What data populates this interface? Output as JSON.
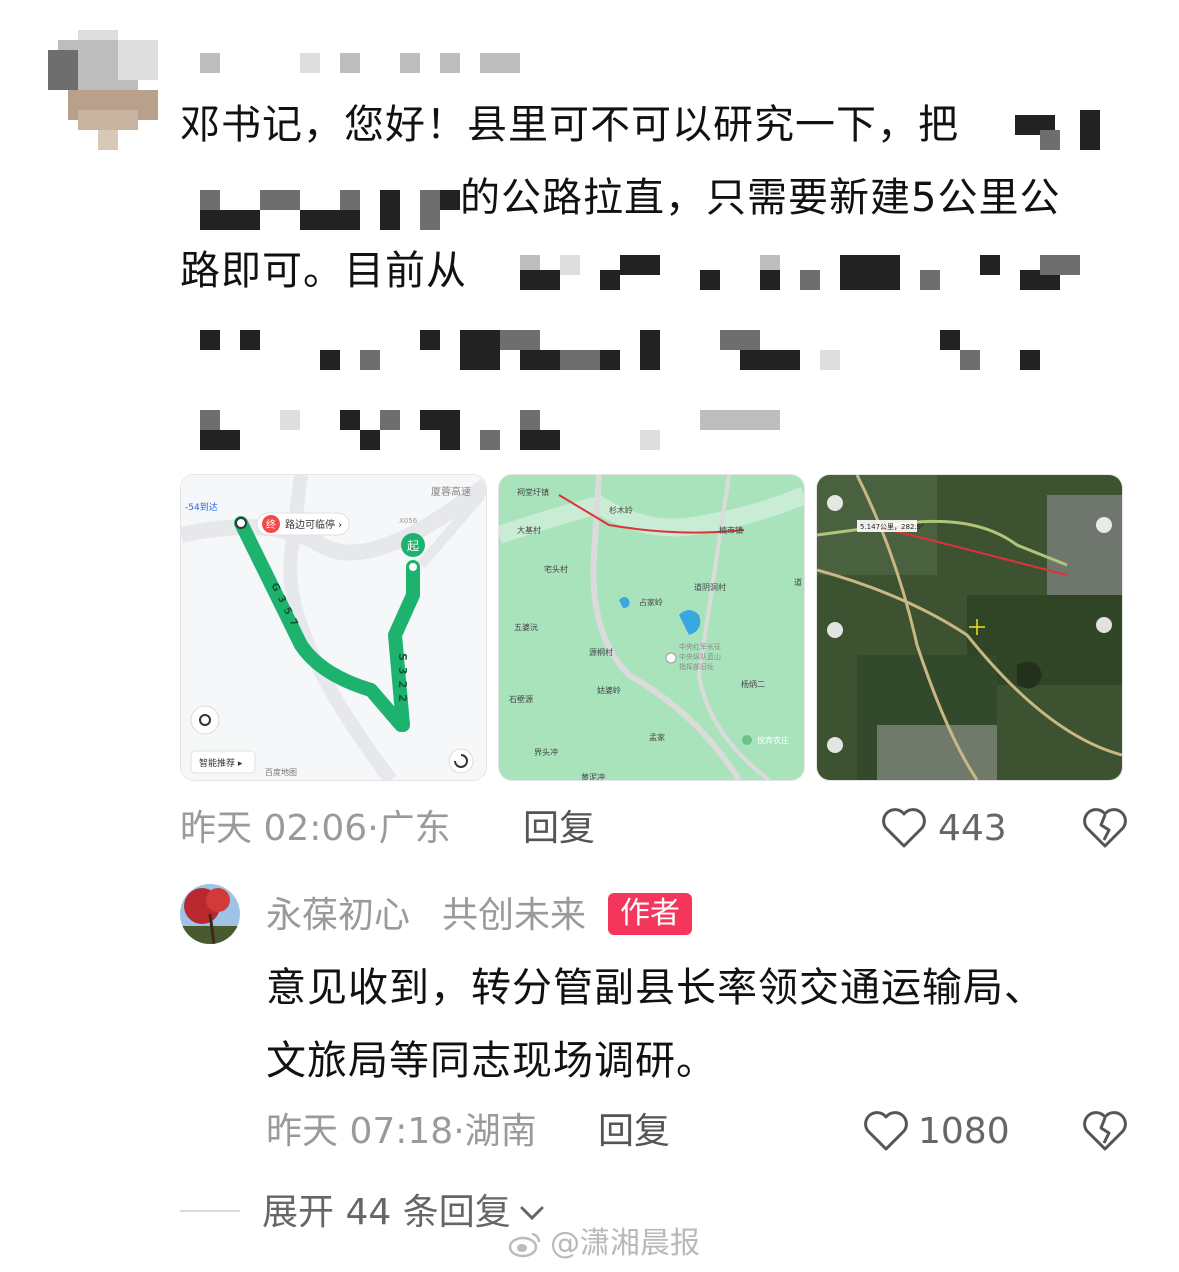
{
  "comment": {
    "lines": [
      "邓书记，您好！县里可不可以研究一下，把",
      "的公路拉直，只需要新建5公里公",
      "路即可。目前从"
    ],
    "time": "昨天 02:06",
    "sep": "·",
    "location": "广东",
    "reply_label": "回复",
    "likes": "443"
  },
  "map1": {
    "label_reach": "-54到达",
    "label_end_badge": "终",
    "label_stop": "路边可临停 ›",
    "label_start": "起",
    "label_road_top": "厦蓉高速",
    "label_code": "X056",
    "route_left": "G357",
    "route_right": "S322",
    "smart": "智能推荐 ▸",
    "brand": "百度地图"
  },
  "map2": {
    "places": [
      "祠堂圩镇",
      "杉木岭",
      "楠市镇",
      "大基村",
      "宅头村",
      "占家岭",
      "道阴洞村",
      "五婆沅",
      "源桐村",
      "中央红军长征",
      "中央纵队蓝山",
      "指挥部旧址",
      "杨炳二",
      "石壁源",
      "姑婆岭",
      "孟家",
      "界头冲",
      "黄泥冲",
      "悦宾农庄",
      "道"
    ]
  },
  "map3": {
    "measure": "5.147公里，282.9°"
  },
  "reply": {
    "author": "永葆初心",
    "author_suffix": "共创未来",
    "badge": "作者",
    "lines": [
      "意见收到，转分管副县长率领交通运输局、",
      "文旅局等同志现场调研。"
    ],
    "time": "昨天 07:18",
    "sep": "·",
    "location": "湖南",
    "reply_label": "回复",
    "likes": "1080"
  },
  "expand": {
    "label": "展开 44 条回复"
  },
  "watermark": "@潇湘晨报",
  "colors": {
    "route": "#1db36e",
    "badge": "#f5365c",
    "measure_line": "#e0313a"
  }
}
